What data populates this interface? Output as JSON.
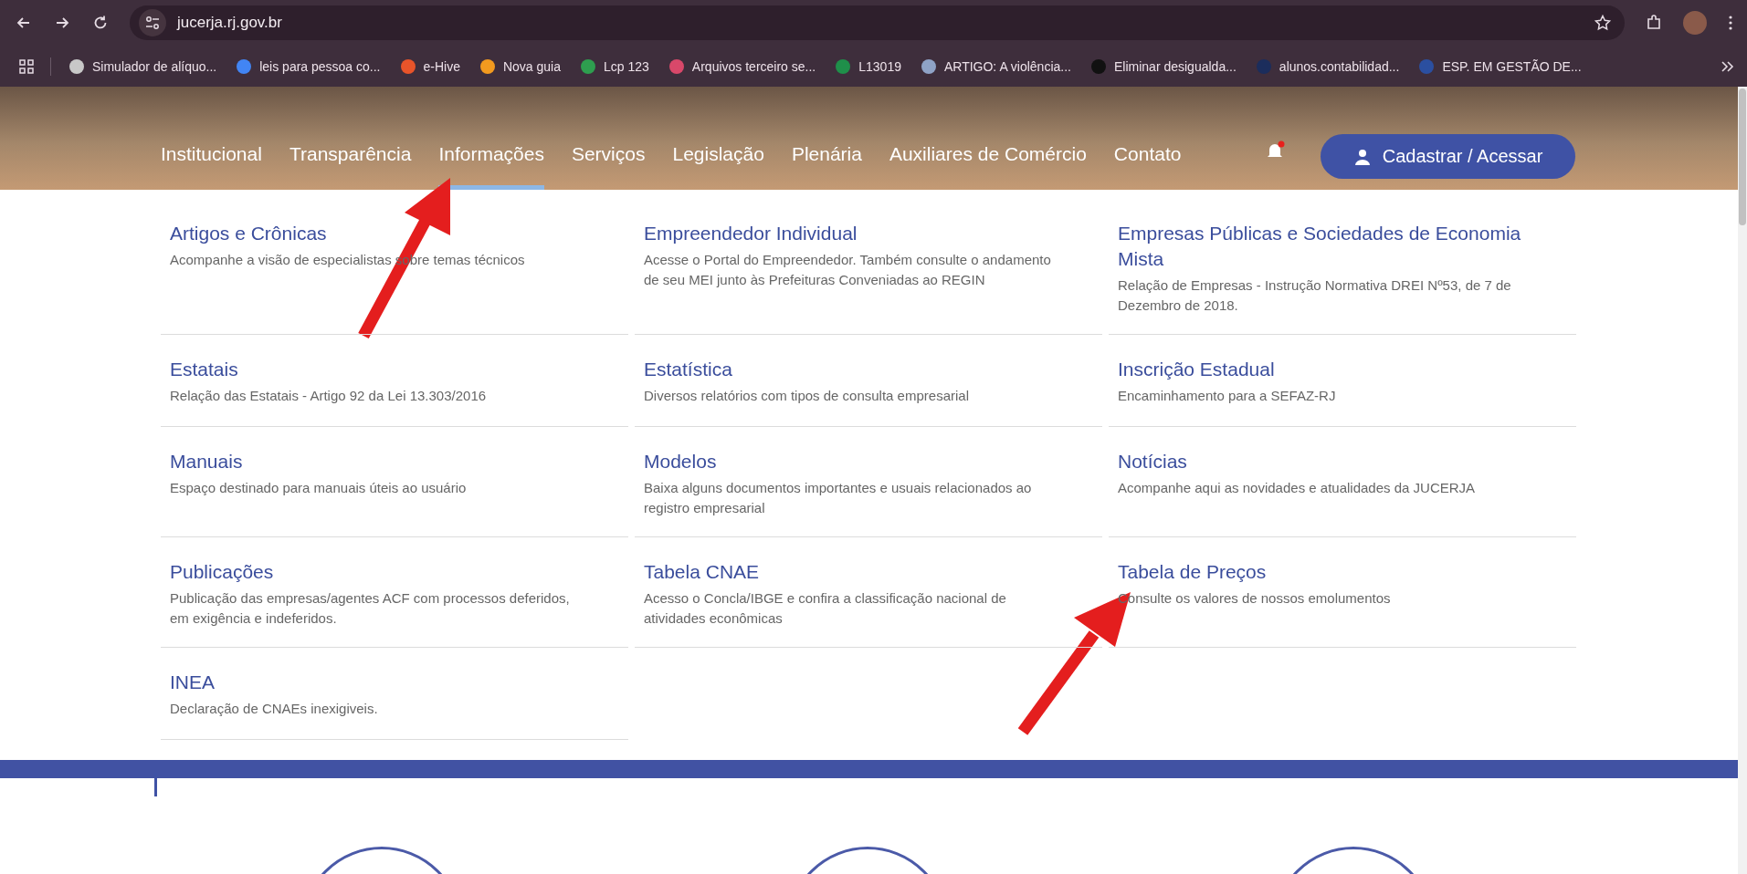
{
  "browser": {
    "address": "jucerja.rj.gov.br",
    "bookmarks": [
      {
        "label": "Simulador de alíquo...",
        "color": "#c8c8c8"
      },
      {
        "label": "leis para pessoa co...",
        "color": "#4285f4"
      },
      {
        "label": "e-Hive",
        "color": "#e8542a"
      },
      {
        "label": "Nova guia",
        "color": "#f29a1f"
      },
      {
        "label": "Lcp 123",
        "color": "#2e9e4f"
      },
      {
        "label": "Arquivos terceiro se...",
        "color": "#d9486a"
      },
      {
        "label": "L13019",
        "color": "#1f8f4a"
      },
      {
        "label": "ARTIGO: A violência...",
        "color": "#8fa3c7"
      },
      {
        "label": "Eliminar desigualda...",
        "color": "#111111"
      },
      {
        "label": "alunos.contabilidad...",
        "color": "#1b2d5c"
      },
      {
        "label": "ESP. EM GESTÃO DE...",
        "color": "#2b4fa0"
      }
    ]
  },
  "nav": {
    "items": [
      {
        "label": "Institucional",
        "selected": false
      },
      {
        "label": "Transparência",
        "selected": false
      },
      {
        "label": "Informações",
        "selected": true
      },
      {
        "label": "Serviços",
        "selected": false
      },
      {
        "label": "Legislação",
        "selected": false
      },
      {
        "label": "Plenária",
        "selected": false
      },
      {
        "label": "Auxiliares de Comércio",
        "selected": false
      },
      {
        "label": "Contato",
        "selected": false
      }
    ],
    "notification": true,
    "account_button": "Cadastrar / Acessar"
  },
  "menu": {
    "items": [
      {
        "title": "Artigos e Crônicas",
        "description": "Acompanhe a visão de especialistas sobre temas técnicos"
      },
      {
        "title": "Empreendedor Individual",
        "description": "Acesse o Portal do Empreendedor. Também consulte o andamento de seu MEI junto às Prefeituras Conveniadas ao REGIN"
      },
      {
        "title": "Empresas Públicas e Sociedades de Economia Mista",
        "description": "Relação de Empresas - Instrução Normativa DREI Nº53, de 7 de Dezembro de 2018."
      },
      {
        "title": "Estatais",
        "description": "Relação das Estatais - Artigo 92 da Lei 13.303/2016"
      },
      {
        "title": "Estatística",
        "description": "Diversos relatórios com tipos de consulta empresarial"
      },
      {
        "title": "Inscrição Estadual",
        "description": "Encaminhamento para a SEFAZ-RJ"
      },
      {
        "title": "Manuais",
        "description": "Espaço destinado para manuais úteis ao usuário"
      },
      {
        "title": "Modelos",
        "description": "Baixa alguns documentos importantes e usuais relacionados ao registro empresarial"
      },
      {
        "title": "Notícias",
        "description": "Acompanhe aqui as novidades e atualidades da JUCERJA"
      },
      {
        "title": "Publicações",
        "description": "Publicação das empresas/agentes ACF com processos deferidos, em exigência e indeferidos."
      },
      {
        "title": "Tabela CNAE",
        "description": "Acesso o Concla/IBGE e confira a classificação nacional de atividades econômicas"
      },
      {
        "title": "Tabela de Preços",
        "description": "Consulte os valores de nossos emolumentos"
      },
      {
        "title": "INEA",
        "description": "Declaração de CNAEs inexigiveis."
      }
    ]
  }
}
